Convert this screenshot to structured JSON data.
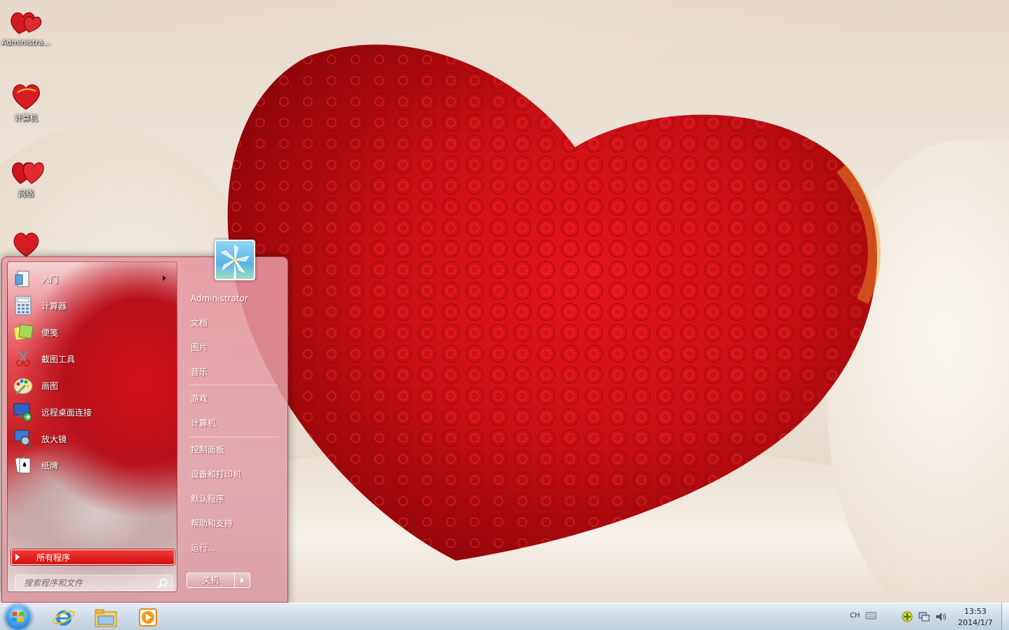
{
  "desktop": {
    "icons": [
      {
        "label": "Administra..."
      },
      {
        "label": "计算机"
      },
      {
        "label": "网络"
      },
      {
        "label": ""
      }
    ]
  },
  "start_menu": {
    "programs": [
      {
        "label": "入门",
        "icon": "getting-started-icon",
        "submenu": true
      },
      {
        "label": "计算器",
        "icon": "calculator-icon"
      },
      {
        "label": "便笺",
        "icon": "sticky-notes-icon"
      },
      {
        "label": "截图工具",
        "icon": "snipping-tool-icon"
      },
      {
        "label": "画图",
        "icon": "paint-icon"
      },
      {
        "label": "远程桌面连接",
        "icon": "remote-desktop-icon"
      },
      {
        "label": "放大镜",
        "icon": "magnifier-icon"
      },
      {
        "label": "纸牌",
        "icon": "solitaire-icon"
      }
    ],
    "all_programs": "所有程序",
    "search_placeholder": "搜索程序和文件",
    "right": {
      "user": "Administrator",
      "documents": "文档",
      "pictures": "图片",
      "music": "音乐",
      "games": "游戏",
      "computer": "计算机",
      "control_panel": "控制面板",
      "devices_printers": "设备和打印机",
      "default_programs": "默认程序",
      "help_support": "帮助和支持",
      "run": "运行..."
    },
    "shutdown": "关机"
  },
  "taskbar": {
    "pinned": [
      "internet-explorer-icon",
      "windows-explorer-icon",
      "media-player-icon"
    ],
    "language": "CH",
    "time": "13:53",
    "date": "2014/1/7"
  },
  "colors": {
    "menu_accent": "#d01010",
    "taskbar": "#cddbe9"
  }
}
